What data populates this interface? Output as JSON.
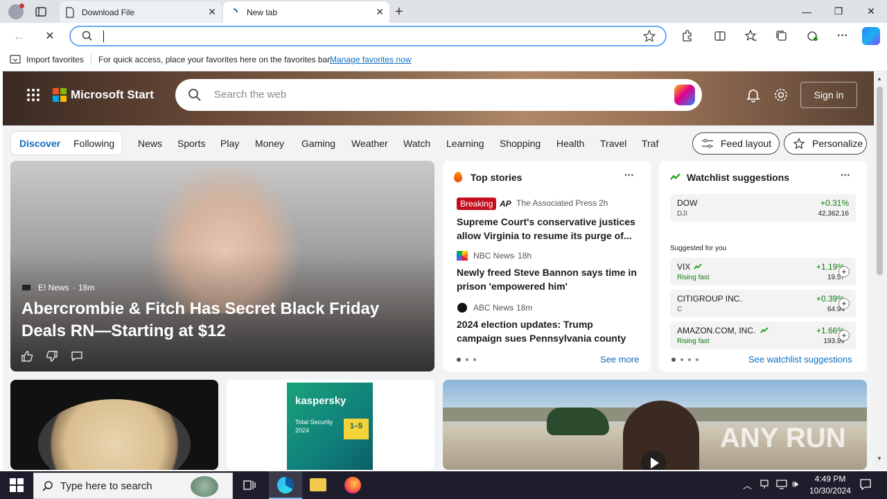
{
  "browser": {
    "tabs": [
      {
        "title": "Download File"
      },
      {
        "title": "New tab"
      }
    ],
    "favbar": {
      "import_label": "Import favorites",
      "hint": "For quick access, place your favorites here on the favorites bar.",
      "manage_link": "Manage favorites now"
    }
  },
  "msn": {
    "logo_text": "Microsoft Start",
    "search_placeholder": "Search the web",
    "signin_label": "Sign in",
    "nav": {
      "discover": "Discover",
      "following": "Following",
      "items": [
        "News",
        "Sports",
        "Play",
        "Money",
        "Gaming",
        "Weather",
        "Watch",
        "Learning",
        "Shopping",
        "Health",
        "Travel",
        "Traf"
      ],
      "feed_layout": "Feed layout",
      "personalize": "Personalize"
    },
    "hero_story": {
      "source": "E! News",
      "age": "18m",
      "title": "Abercrombie & Fitch Has Secret Black Friday Deals RN—Starting at $12"
    },
    "top_stories": {
      "header": "Top stories",
      "breaking": "Breaking",
      "items": [
        {
          "source": "The Associated Press",
          "age": "2h",
          "headline": "Supreme Court's conservative justices allow Virginia to resume its purge of..."
        },
        {
          "source": "NBC News",
          "age": "18h",
          "headline": "Newly freed Steve Bannon says time in prison 'empowered him'"
        },
        {
          "source": "ABC News",
          "age": "18m",
          "headline": "2024 election updates: Trump campaign sues Pennsylvania county"
        }
      ],
      "see_more": "See more"
    },
    "watchlist": {
      "header": "Watchlist suggestions",
      "suggested_label": "Suggested for you",
      "primary": {
        "name": "DOW",
        "sub": "DJI",
        "change": "+0.31%",
        "price": "42,362.16"
      },
      "suggestions": [
        {
          "name": "VIX",
          "sub": "Rising fast",
          "change": "+1.19%",
          "price": "19.57"
        },
        {
          "name": "CITIGROUP INC.",
          "sub": "C",
          "change": "+0.39%",
          "price": "64.94"
        },
        {
          "name": "AMAZON.COM, INC.",
          "sub": "Rising fast",
          "change": "+1.66%",
          "price": "193.99"
        }
      ],
      "see_link": "See watchlist suggestions"
    },
    "promo": {
      "brand": "kaspersky",
      "product": "Total Security",
      "year": "2024",
      "devices": "1–5"
    },
    "watermark": "ANY RUN"
  },
  "taskbar": {
    "search_placeholder": "Type here to search",
    "time": "4:49 PM",
    "date": "10/30/2024"
  },
  "colors": {
    "accent": "#0f6cbd",
    "breaking": "#c50f1f",
    "positive": "#0e7a0d",
    "taskbar": "#1d1d2b"
  }
}
